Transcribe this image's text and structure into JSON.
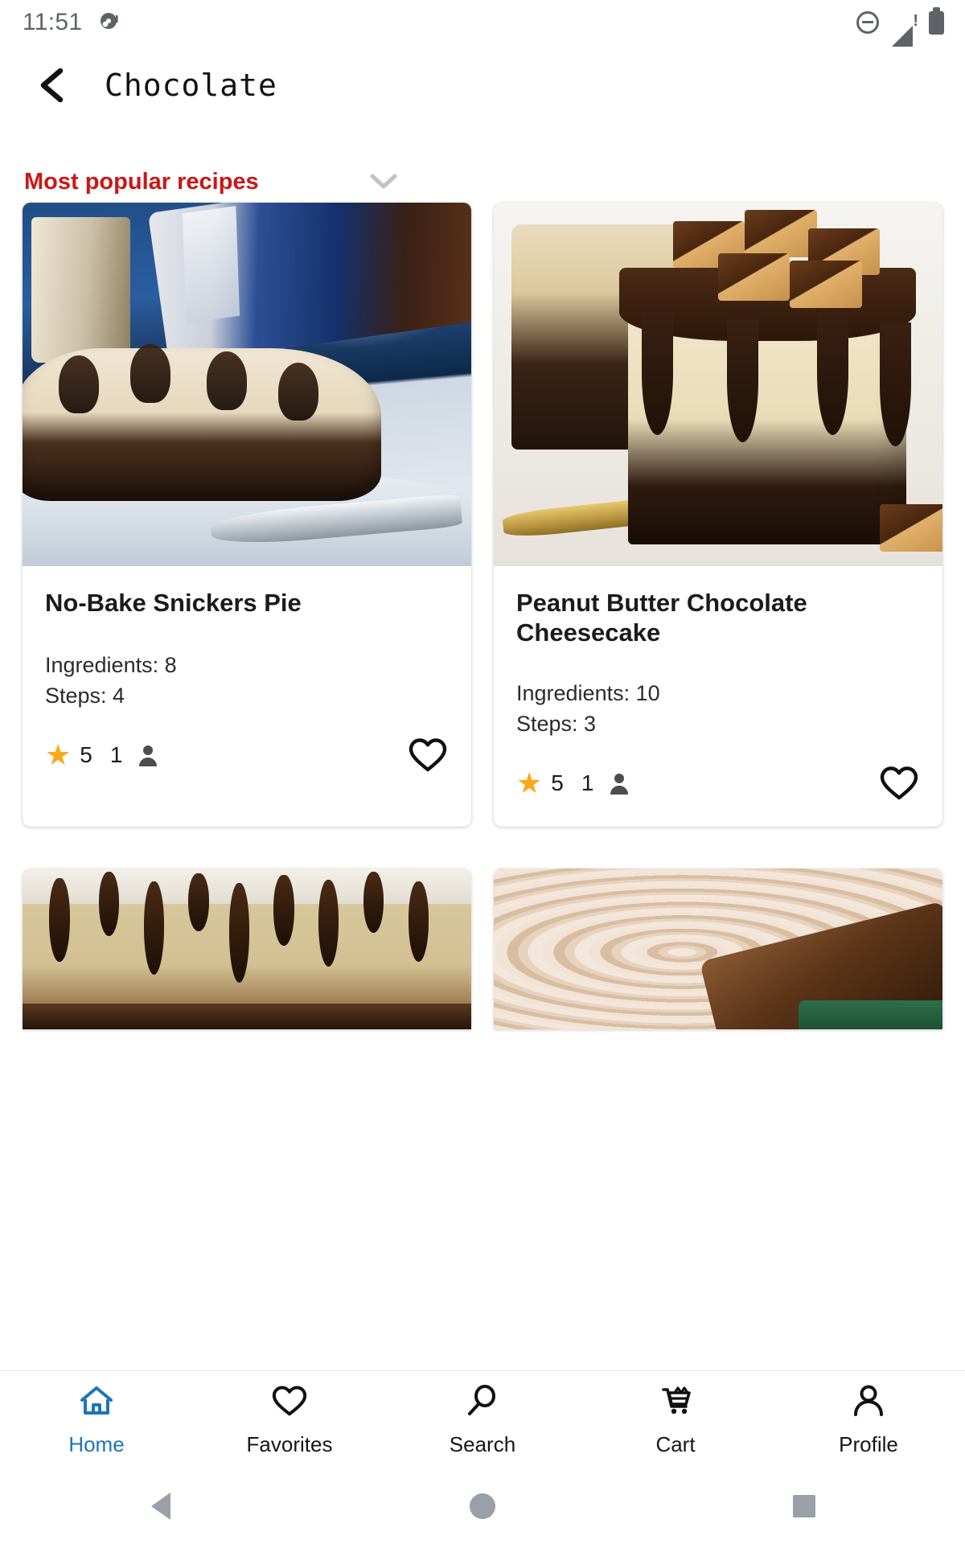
{
  "status_bar": {
    "time": "11:51",
    "icons": [
      "notification-dot-icon",
      "do-not-disturb-icon",
      "signal-warning-icon",
      "battery-icon"
    ]
  },
  "app_bar": {
    "back_icon": "back-chevron-icon",
    "title": "Chocolate"
  },
  "section": {
    "title": "Most popular recipes",
    "title_color": "#cc1616",
    "chevron_icon": "chevron-down-icon"
  },
  "recipes": [
    {
      "title": "No-Bake Snickers Pie",
      "ingredients_label": "Ingredients: 8",
      "steps_label": "Steps: 4",
      "rating": "5",
      "rating_count": "1",
      "star_icon": "star-icon",
      "person_icon": "person-icon",
      "favorite_icon": "heart-outline-icon",
      "photo": "snickers-pie-photo"
    },
    {
      "title": "Peanut Butter Chocolate Cheesecake",
      "ingredients_label": "Ingredients: 10",
      "steps_label": "Steps: 3",
      "rating": "5",
      "rating_count": "1",
      "star_icon": "star-icon",
      "person_icon": "person-icon",
      "favorite_icon": "heart-outline-icon",
      "photo": "peanut-butter-cheesecake-photo"
    },
    {
      "title": "",
      "ingredients_label": "",
      "steps_label": "",
      "rating": "",
      "rating_count": "",
      "photo": "peanut-butter-pie-photo"
    },
    {
      "title": "",
      "ingredients_label": "",
      "steps_label": "",
      "rating": "",
      "rating_count": "",
      "photo": "swirl-cheesecake-photo"
    }
  ],
  "bottom_nav": {
    "active_color": "#1b75bc",
    "items": [
      {
        "label": "Home",
        "icon": "home-icon",
        "active": true
      },
      {
        "label": "Favorites",
        "icon": "heart-outline-icon",
        "active": false
      },
      {
        "label": "Search",
        "icon": "search-icon",
        "active": false
      },
      {
        "label": "Cart",
        "icon": "cart-icon",
        "active": false
      },
      {
        "label": "Profile",
        "icon": "person-icon",
        "active": false
      }
    ]
  },
  "system_nav": {
    "back": "android-back-icon",
    "home": "android-home-icon",
    "recents": "android-recents-icon"
  }
}
